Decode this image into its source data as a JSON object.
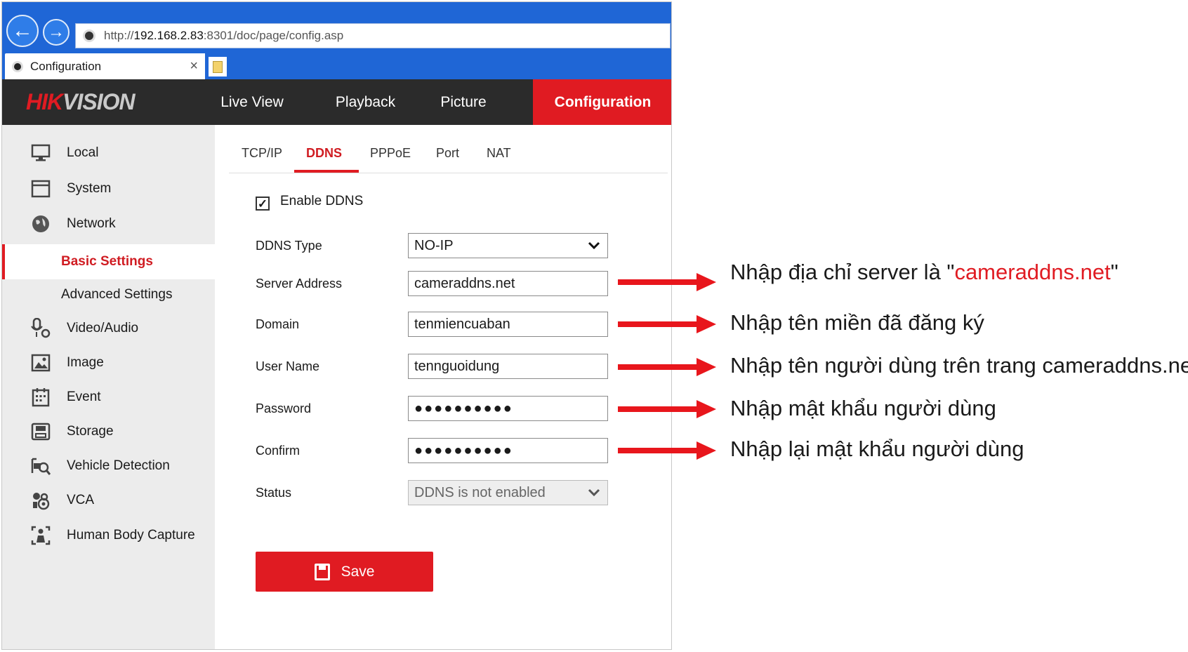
{
  "browser": {
    "url_prefix": "http://",
    "url_host": "192.168.2.83",
    "url_rest": ":8301/doc/page/config.asp",
    "tab_title": "Configuration",
    "tab_close": "×"
  },
  "app": {
    "logo_hik": "HIK",
    "logo_vision": "VISION",
    "menu": [
      "Live View",
      "Playback",
      "Picture",
      "Configuration"
    ],
    "active_menu": "Configuration",
    "brand_color": "#e01b22"
  },
  "sidebar": {
    "items": [
      {
        "label": "Local",
        "icon": "monitor-icon"
      },
      {
        "label": "System",
        "icon": "system-icon"
      },
      {
        "label": "Network",
        "icon": "globe-icon"
      },
      {
        "label": "Basic Settings",
        "sub": true,
        "active": true
      },
      {
        "label": "Advanced Settings",
        "sub": true
      },
      {
        "label": "Video/Audio",
        "icon": "microphone-icon"
      },
      {
        "label": "Image",
        "icon": "image-icon"
      },
      {
        "label": "Event",
        "icon": "calendar-icon"
      },
      {
        "label": "Storage",
        "icon": "storage-icon"
      },
      {
        "label": "Vehicle Detection",
        "icon": "vehicle-search-icon"
      },
      {
        "label": "VCA",
        "icon": "vca-icon"
      },
      {
        "label": "Human Body Capture",
        "icon": "body-capture-icon"
      }
    ]
  },
  "tabs": [
    "TCP/IP",
    "DDNS",
    "PPPoE",
    "Port",
    "NAT"
  ],
  "active_tab": "DDNS",
  "form": {
    "enable_label": "Enable DDNS",
    "enable_checked": true,
    "check_mark": "✓",
    "ddns_type_label": "DDNS Type",
    "ddns_type_value": "NO-IP",
    "server_label": "Server Address",
    "server_value": "cameraddns.net",
    "domain_label": "Domain",
    "domain_value": "tenmiencuaban",
    "user_label": "User Name",
    "user_value": "tennguoidung",
    "password_label": "Password",
    "password_value": "●●●●●●●●●●",
    "confirm_label": "Confirm",
    "confirm_value": "●●●●●●●●●●",
    "status_label": "Status",
    "status_value": "DDNS is not enabled",
    "caret": "⌄",
    "save_label": "Save"
  },
  "annotations": {
    "server_prefix": "Nhập địa chỉ server là \"",
    "server_highlight": "cameraddns.net",
    "server_suffix": "\"",
    "domain": "Nhập tên miền đã đăng ký",
    "user": "Nhập tên người dùng trên trang cameraddns.net",
    "password": "Nhập mật khẩu người dùng",
    "confirm": "Nhập lại mật khẩu người dùng",
    "arrow_color": "#e8161c"
  }
}
